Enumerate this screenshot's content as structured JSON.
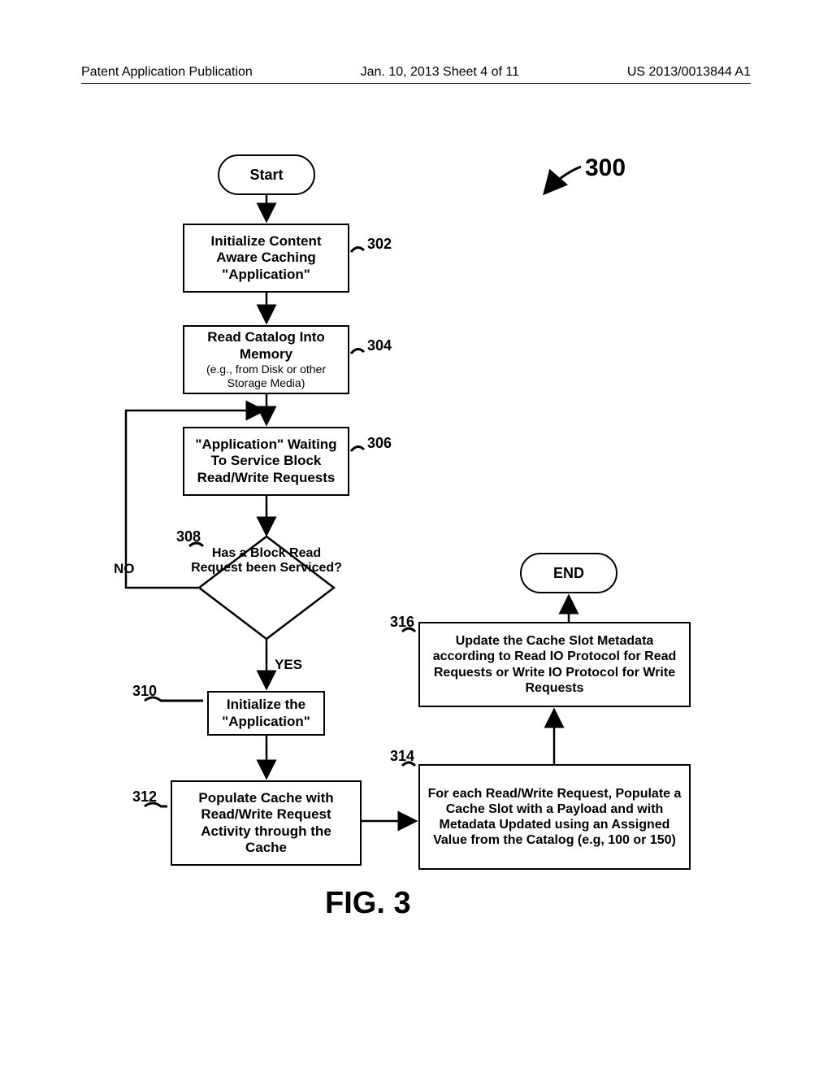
{
  "header": {
    "left": "Patent Application Publication",
    "center": "Jan. 10, 2013  Sheet 4 of 11",
    "right": "US 2013/0013844 A1"
  },
  "figure_number": "300",
  "terminators": {
    "start": "Start",
    "end": "END"
  },
  "steps": {
    "302": "Initialize Content Aware Caching \"Application\"",
    "304_main": "Read Catalog Into Memory",
    "304_sub": "(e.g., from Disk or other Storage Media)",
    "306": "\"Application\" Waiting To Service Block Read/Write Requests",
    "308": "Has a Block Read Request been Serviced?",
    "310": "Initialize the \"Application\"",
    "312": "Populate Cache with Read/Write Request Activity through the Cache",
    "314": "For each Read/Write Request, Populate a Cache Slot with a Payload and with Metadata Updated using an Assigned Value from the Catalog (e.g, 100 or 150)",
    "316": "Update the Cache Slot Metadata according to Read IO Protocol for Read Requests or Write IO Protocol for Write Requests"
  },
  "refs": {
    "302": "302",
    "304": "304",
    "306": "306",
    "308": "308",
    "310": "310",
    "312": "312",
    "314": "314",
    "316": "316"
  },
  "decision": {
    "no": "NO",
    "yes": "YES"
  },
  "figlabel": "FIG.  3",
  "chart_data": {
    "type": "flowchart",
    "title": "FIG. 3 — Content Aware Caching process (ref 300)",
    "nodes": [
      {
        "id": "start",
        "kind": "terminator",
        "label": "Start"
      },
      {
        "id": "302",
        "kind": "process",
        "label": "Initialize Content Aware Caching \"Application\""
      },
      {
        "id": "304",
        "kind": "process",
        "label": "Read Catalog Into Memory (e.g., from Disk or other Storage Media)"
      },
      {
        "id": "306",
        "kind": "process",
        "label": "\"Application\" Waiting To Service Block Read/Write Requests"
      },
      {
        "id": "308",
        "kind": "decision",
        "label": "Has a Block Read Request been Serviced?"
      },
      {
        "id": "310",
        "kind": "process",
        "label": "Initialize the \"Application\""
      },
      {
        "id": "312",
        "kind": "process",
        "label": "Populate Cache with Read/Write Request Activity through the Cache"
      },
      {
        "id": "314",
        "kind": "process",
        "label": "For each Read/Write Request, Populate a Cache Slot with a Payload and with Metadata Updated using an Assigned Value from the Catalog (e.g, 100 or 150)"
      },
      {
        "id": "316",
        "kind": "process",
        "label": "Update the Cache Slot Metadata according to Read IO Protocol for Read Requests or Write IO Protocol for Write Requests"
      },
      {
        "id": "end",
        "kind": "terminator",
        "label": "END"
      }
    ],
    "edges": [
      {
        "from": "start",
        "to": "302"
      },
      {
        "from": "302",
        "to": "304"
      },
      {
        "from": "304",
        "to": "306"
      },
      {
        "from": "306",
        "to": "308"
      },
      {
        "from": "308",
        "to": "306",
        "label": "NO"
      },
      {
        "from": "308",
        "to": "310",
        "label": "YES"
      },
      {
        "from": "310",
        "to": "312"
      },
      {
        "from": "312",
        "to": "314"
      },
      {
        "from": "314",
        "to": "316"
      },
      {
        "from": "316",
        "to": "end"
      }
    ]
  }
}
